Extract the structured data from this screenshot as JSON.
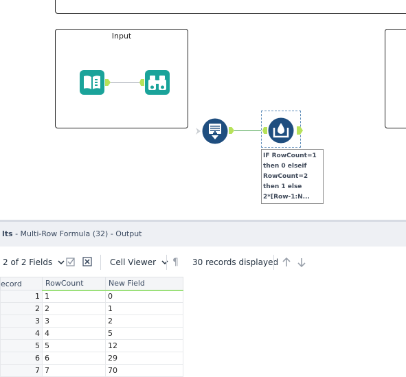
{
  "canvas": {
    "container_title": "Input"
  },
  "annotation": {
    "lines": [
      "IF RowCount=1",
      "then 0 elseif",
      "RowCount=2",
      "then 1 else",
      "2*[Row-1:N..."
    ]
  },
  "results": {
    "title_prefix": "lts",
    "title_rest": " - Multi-Row Formula (32) - Output",
    "fields_label": "2 of 2 Fields",
    "cell_viewer_label": "Cell Viewer",
    "records_label": "30 records displayed",
    "columns": [
      "ecord",
      "RowCount",
      "New Field"
    ],
    "rows": [
      [
        "1",
        "1",
        "0"
      ],
      [
        "2",
        "2",
        "1"
      ],
      [
        "3",
        "3",
        "2"
      ],
      [
        "4",
        "4",
        "5"
      ],
      [
        "5",
        "5",
        "12"
      ],
      [
        "6",
        "6",
        "29"
      ],
      [
        "7",
        "7",
        "70"
      ]
    ]
  },
  "colors": {
    "teal": "#1aa39a",
    "navy": "#1f4e7f",
    "anchor": "#b7e25a",
    "connector_green": "#43a047"
  },
  "icons": [
    "input-book-icon",
    "browse-binoculars-icon",
    "record-id-icon",
    "multirow-formula-icon",
    "fields-chevron-icon",
    "checkbox-icon",
    "close-box-icon",
    "chevron-down-icon",
    "pilcrow-icon",
    "arrow-up-icon",
    "arrow-down-icon"
  ]
}
